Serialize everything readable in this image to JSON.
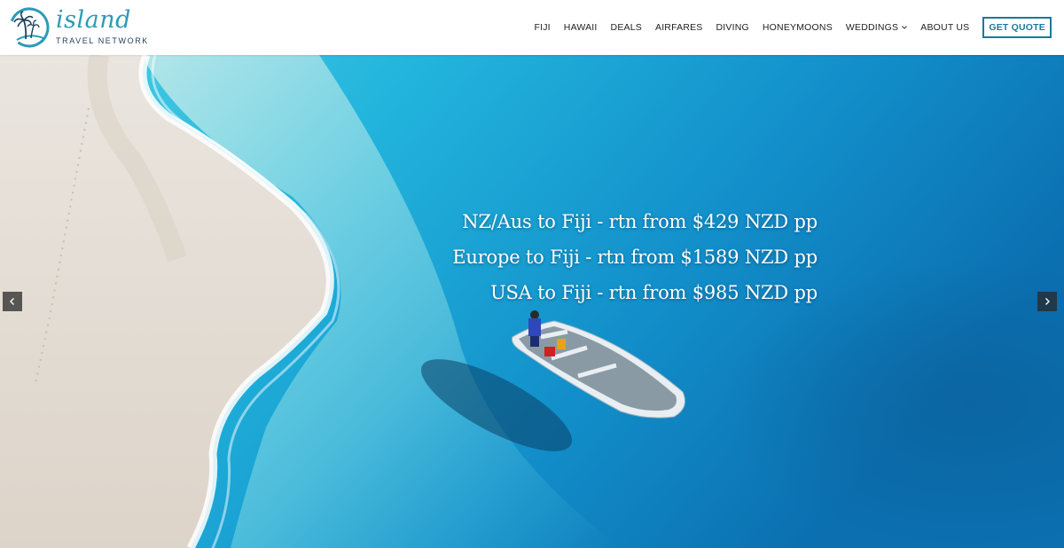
{
  "logo": {
    "wordmark": "island",
    "tagline": "TRAVEL NETWORK",
    "icon": "palm-tree-logo-icon"
  },
  "nav": {
    "items": [
      {
        "label": "FIJI"
      },
      {
        "label": "HAWAII"
      },
      {
        "label": "DEALS"
      },
      {
        "label": "AIRFARES"
      },
      {
        "label": "DIVING"
      },
      {
        "label": "HONEYMOONS"
      },
      {
        "label": "WEDDINGS",
        "has_dropdown": true
      },
      {
        "label": "ABOUT US"
      }
    ],
    "cta_label": "GET QUOTE"
  },
  "hero": {
    "headlines": [
      "NZ/Aus to Fiji - rtn from $429 NZD pp",
      "Europe to Fiji - rtn from $1589 NZD pp",
      "USA to Fiji - rtn from $985 NZD pp"
    ],
    "prev_icon": "chevron-left-icon",
    "next_icon": "chevron-right-icon"
  },
  "colors": {
    "brand_teal": "#2a9bb8",
    "brand_navy": "#1d3f5c",
    "cta_border": "#1b7a9a",
    "ocean": "#1a9fd0",
    "sand": "#ece6dd"
  }
}
